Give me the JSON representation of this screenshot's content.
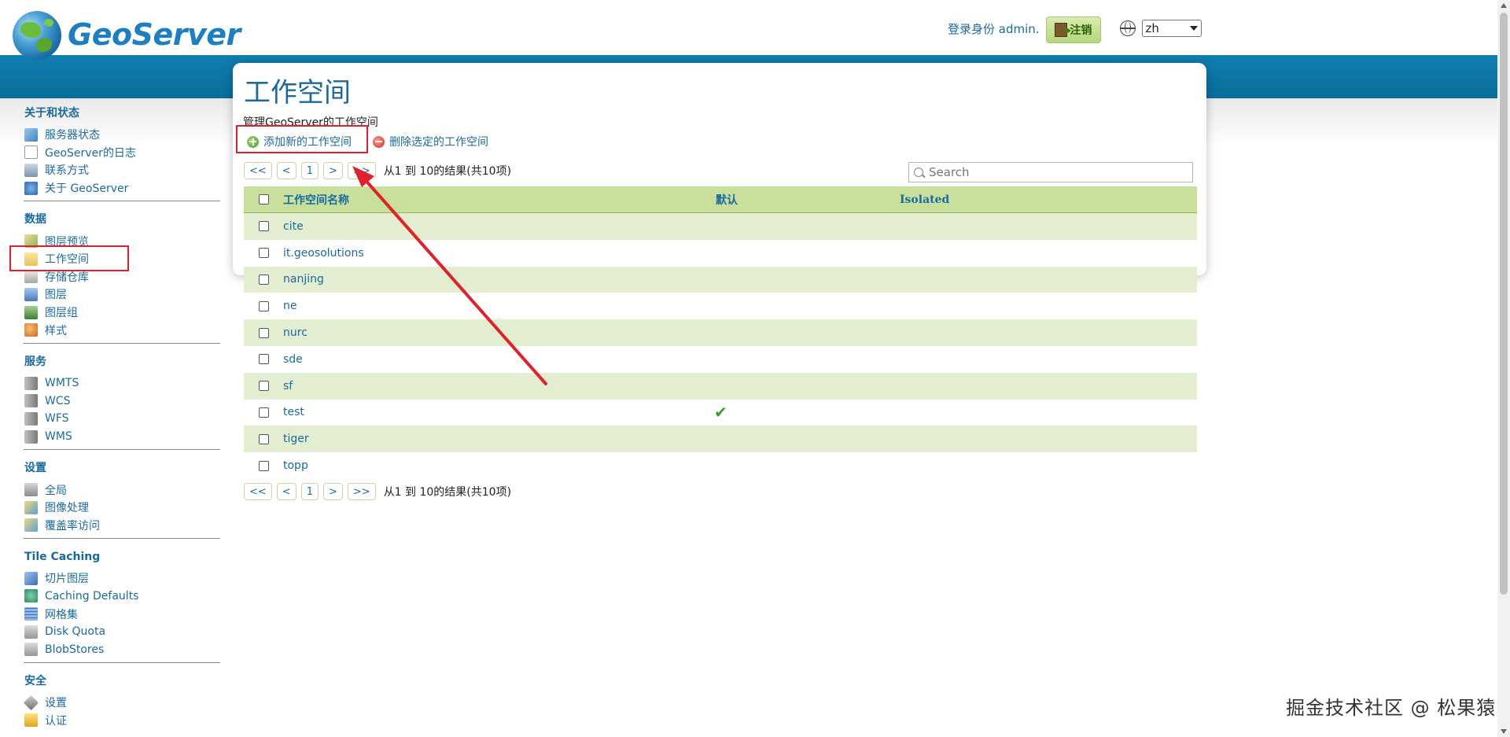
{
  "app": {
    "logo_text": "GeoServer"
  },
  "header": {
    "login_text": "登录身份 admin.",
    "logout_label": "注销",
    "language": "zh"
  },
  "sidebar": {
    "sections": [
      {
        "title": "关于和状态",
        "items": [
          {
            "label": "服务器状态",
            "icon": "server-status-icon"
          },
          {
            "label": "GeoServer的日志",
            "icon": "log-icon"
          },
          {
            "label": "联系方式",
            "icon": "contact-icon"
          },
          {
            "label": "关于 GeoServer",
            "icon": "info-icon"
          }
        ]
      },
      {
        "title": "数据",
        "items": [
          {
            "label": "图层预览",
            "icon": "layer-preview-icon"
          },
          {
            "label": "工作空间",
            "icon": "folder-icon"
          },
          {
            "label": "存储仓库",
            "icon": "store-icon"
          },
          {
            "label": "图层",
            "icon": "layer-icon"
          },
          {
            "label": "图层组",
            "icon": "layer-group-icon"
          },
          {
            "label": "样式",
            "icon": "style-icon"
          }
        ]
      },
      {
        "title": "服务",
        "items": [
          {
            "label": "WMTS",
            "icon": "service-icon"
          },
          {
            "label": "WCS",
            "icon": "service-icon"
          },
          {
            "label": "WFS",
            "icon": "service-icon"
          },
          {
            "label": "WMS",
            "icon": "service-icon"
          }
        ]
      },
      {
        "title": "设置",
        "items": [
          {
            "label": "全局",
            "icon": "global-settings-icon"
          },
          {
            "label": "图像处理",
            "icon": "image-processing-icon"
          },
          {
            "label": "覆盖率访问",
            "icon": "coverage-access-icon"
          }
        ]
      },
      {
        "title": "Tile Caching",
        "items": [
          {
            "label": "切片图层",
            "icon": "tile-layers-icon"
          },
          {
            "label": "Caching Defaults",
            "icon": "caching-defaults-icon"
          },
          {
            "label": "网格集",
            "icon": "gridset-icon"
          },
          {
            "label": "Disk Quota",
            "icon": "disk-quota-icon"
          },
          {
            "label": "BlobStores",
            "icon": "blobstore-icon"
          }
        ]
      },
      {
        "title": "安全",
        "items": [
          {
            "label": "设置",
            "icon": "security-settings-icon"
          },
          {
            "label": "认证",
            "icon": "authentication-icon"
          }
        ]
      }
    ]
  },
  "main": {
    "title": "工作空间",
    "description": "管理GeoServer的工作空间",
    "add_label": "添加新的工作空间",
    "remove_label": "删除选定的工作空间",
    "pager": {
      "first": "<<",
      "prev": "<",
      "page": "1",
      "next": ">",
      "last": ">>",
      "info": "从1 到 10的结果(共10项)"
    },
    "search_placeholder": "Search",
    "table": {
      "headers": [
        "工作空间名称",
        "默认",
        "Isolated"
      ],
      "rows": [
        {
          "name": "cite",
          "default": false
        },
        {
          "name": "it.geosolutions",
          "default": false
        },
        {
          "name": "nanjing",
          "default": false
        },
        {
          "name": "ne",
          "default": false
        },
        {
          "name": "nurc",
          "default": false
        },
        {
          "name": "sde",
          "default": false
        },
        {
          "name": "sf",
          "default": false
        },
        {
          "name": "test",
          "default": true
        },
        {
          "name": "tiger",
          "default": false
        },
        {
          "name": "topp",
          "default": false
        }
      ]
    }
  },
  "watermark": "掘金技术社区 @ 松果猿",
  "colors": {
    "accent": "#1a6aa0",
    "band": "#0e7fb0",
    "table_header": "#c9e09c",
    "row_alt": "#e3eed1",
    "highlight": "#e0202a"
  }
}
